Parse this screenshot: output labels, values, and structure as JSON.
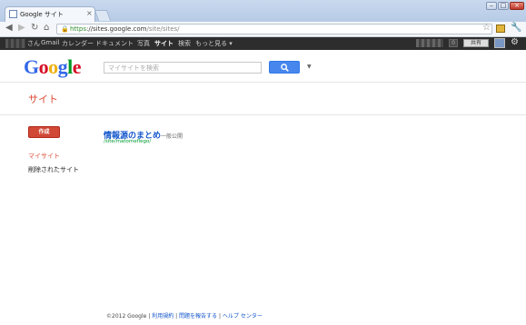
{
  "browser": {
    "tab_title": "Google サイト",
    "tab_close": "×",
    "url_https": "https",
    "url_sep": "://",
    "url_host": "sites.google.com",
    "url_path": "/site/sites/",
    "window_buttons": {
      "min": "–",
      "max": "□",
      "close": "×"
    }
  },
  "gbar": {
    "items": [
      "さん",
      "Gmail",
      "カレンダー",
      "ドキュメント",
      "写真",
      "サイト",
      "検索",
      "もっと見る ▾"
    ],
    "active_item": "サイト",
    "notification_count": "0",
    "share_label": "共有"
  },
  "header": {
    "logo": [
      "G",
      "o",
      "o",
      "g",
      "l",
      "e"
    ],
    "logo_colors": [
      "#3369e8",
      "#d50f25",
      "#eeb211",
      "#3369e8",
      "#009925",
      "#d50f25"
    ],
    "search_placeholder": "マイサイトを検索",
    "search_value": ""
  },
  "page_title": "サイト",
  "sidebar": {
    "create_label": "作成",
    "items": [
      "マイサイト",
      "削除されたサイト"
    ]
  },
  "sites": [
    {
      "name": "情報源のまとめ",
      "visibility": "一般公開",
      "url": "/site/matomeflego/"
    }
  ],
  "footer": {
    "copyright": "©2012 Google",
    "links": [
      "利用規約",
      "問題を報告する",
      "ヘルプ センター"
    ]
  },
  "colors": {
    "accent_red": "#dd4b39",
    "link_blue": "#1155cc",
    "search_blue": "#4787ed",
    "gbar_bg": "#2d2d2d"
  }
}
